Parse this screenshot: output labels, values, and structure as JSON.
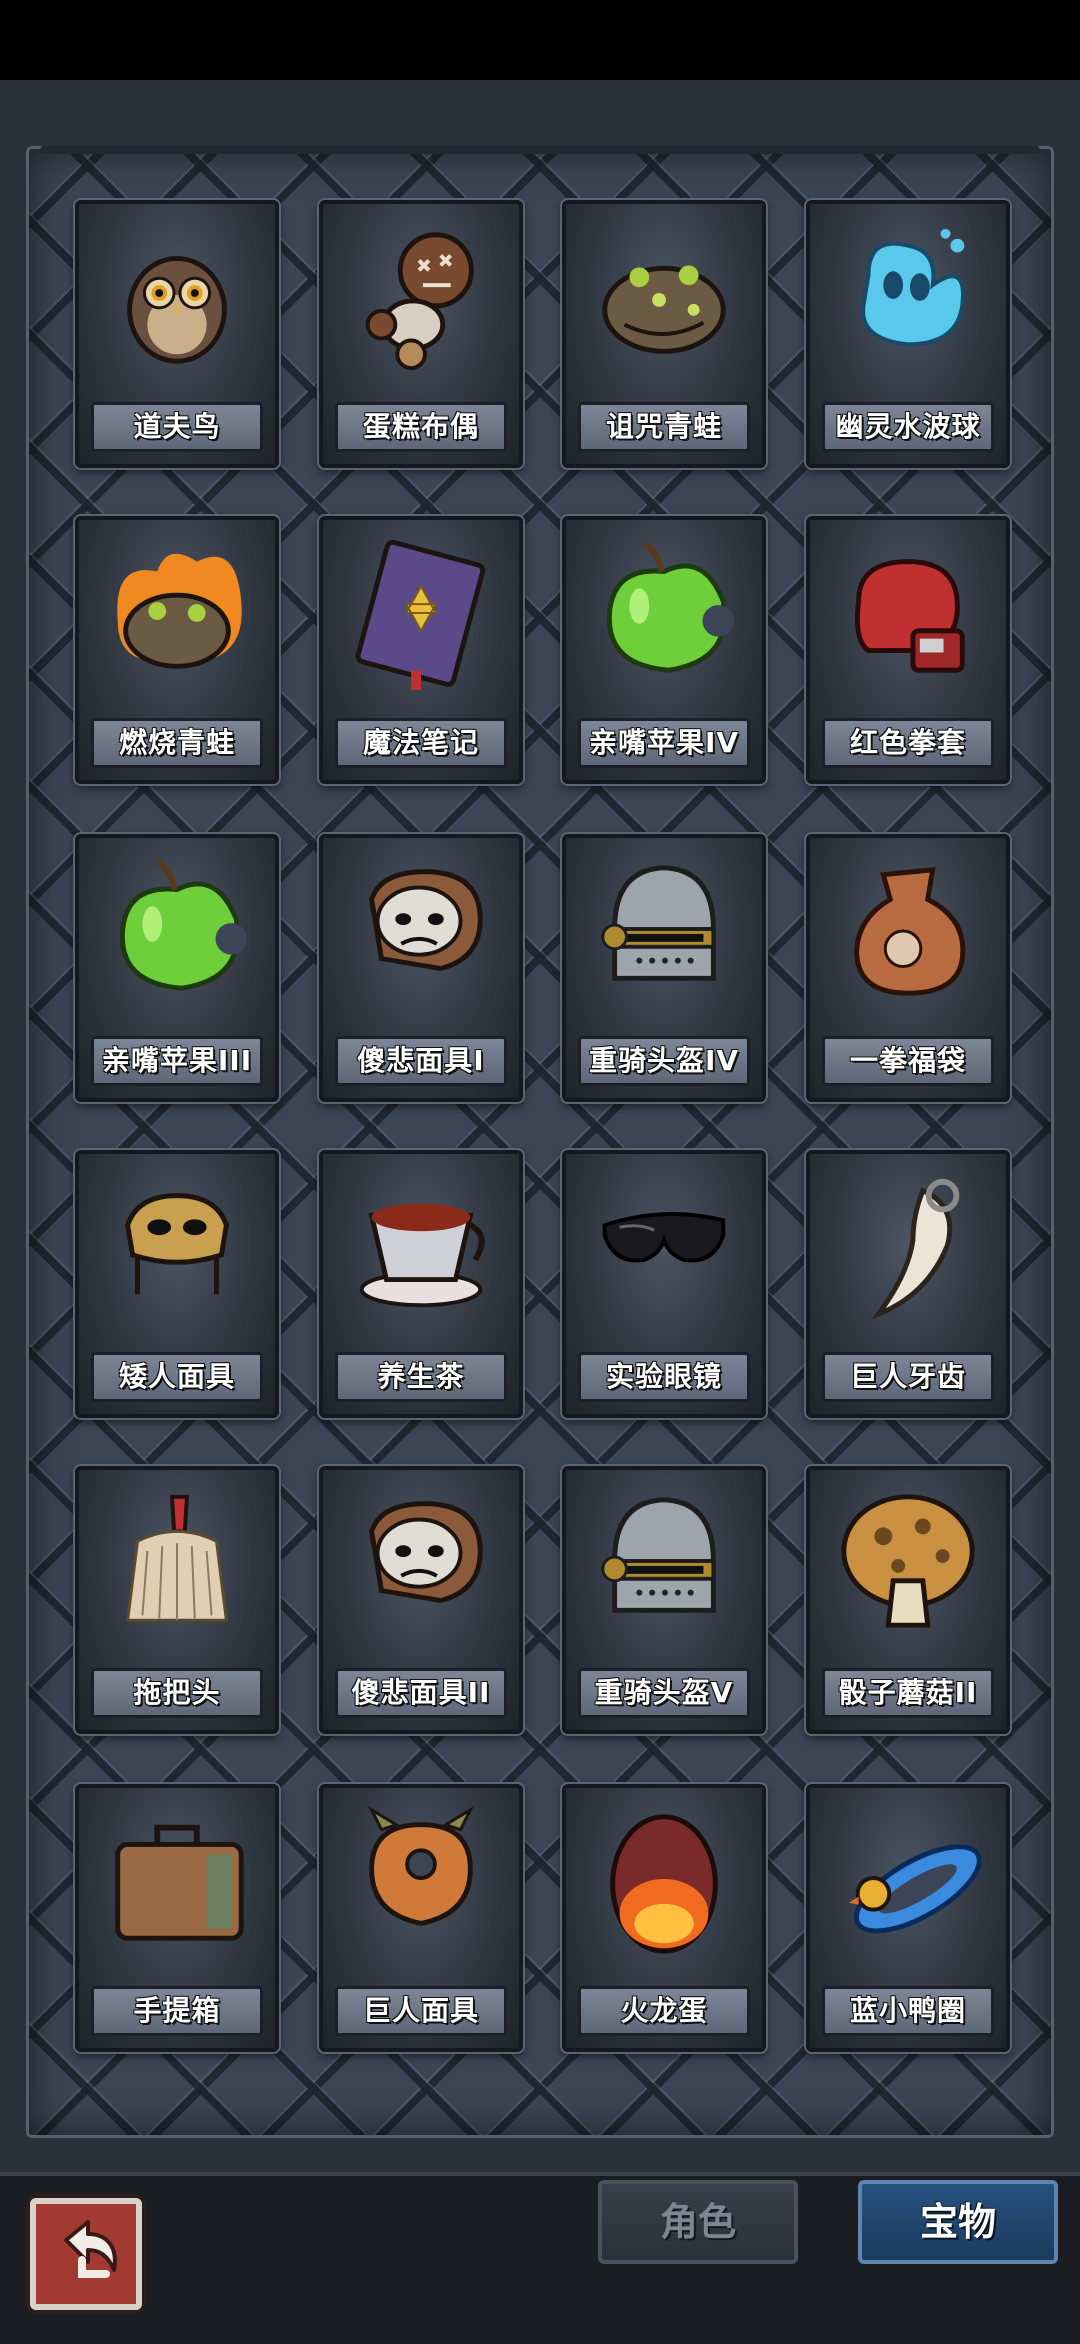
{
  "tabs": {
    "role_label": "角色",
    "treasure_label": "宝物",
    "active": "宝物"
  },
  "items": [
    {
      "name": "道夫鸟",
      "icon": "owl-icon"
    },
    {
      "name": "蛋糕布偶",
      "icon": "voodoo-doll-icon"
    },
    {
      "name": "诅咒青蛙",
      "icon": "cursed-frog-icon"
    },
    {
      "name": "幽灵水波球",
      "icon": "water-ball-icon"
    },
    {
      "name": "燃烧青蛙",
      "icon": "burning-frog-icon"
    },
    {
      "name": "魔法笔记",
      "icon": "magic-book-icon"
    },
    {
      "name": "亲嘴苹果IV",
      "icon": "bitten-apple-icon"
    },
    {
      "name": "红色拳套",
      "icon": "boxing-glove-icon"
    },
    {
      "name": "亲嘴苹果III",
      "icon": "bitten-apple-icon"
    },
    {
      "name": "傻悲面具I",
      "icon": "sad-mask-icon"
    },
    {
      "name": "重骑头盔IV",
      "icon": "knight-helmet-icon"
    },
    {
      "name": "一拳福袋",
      "icon": "lucky-bag-icon"
    },
    {
      "name": "矮人面具",
      "icon": "dwarf-mask-icon"
    },
    {
      "name": "养生茶",
      "icon": "tea-cup-icon"
    },
    {
      "name": "实验眼镜",
      "icon": "sunglasses-icon"
    },
    {
      "name": "巨人牙齿",
      "icon": "giant-tooth-icon"
    },
    {
      "name": "拖把头",
      "icon": "mop-head-icon"
    },
    {
      "name": "傻悲面具II",
      "icon": "sad-mask-icon"
    },
    {
      "name": "重骑头盔V",
      "icon": "knight-helmet-icon"
    },
    {
      "name": "骰子蘑菇II",
      "icon": "mushroom-icon"
    },
    {
      "name": "手提箱",
      "icon": "suitcase-icon"
    },
    {
      "name": "巨人面具",
      "icon": "giant-mask-icon"
    },
    {
      "name": "火龙蛋",
      "icon": "dragon-egg-icon"
    },
    {
      "name": "蓝小鸭圈",
      "icon": "duck-float-icon"
    }
  ],
  "colors": {
    "panel": "#3c4555",
    "active_tab": "#27527f",
    "back_button": "#a33a31"
  }
}
